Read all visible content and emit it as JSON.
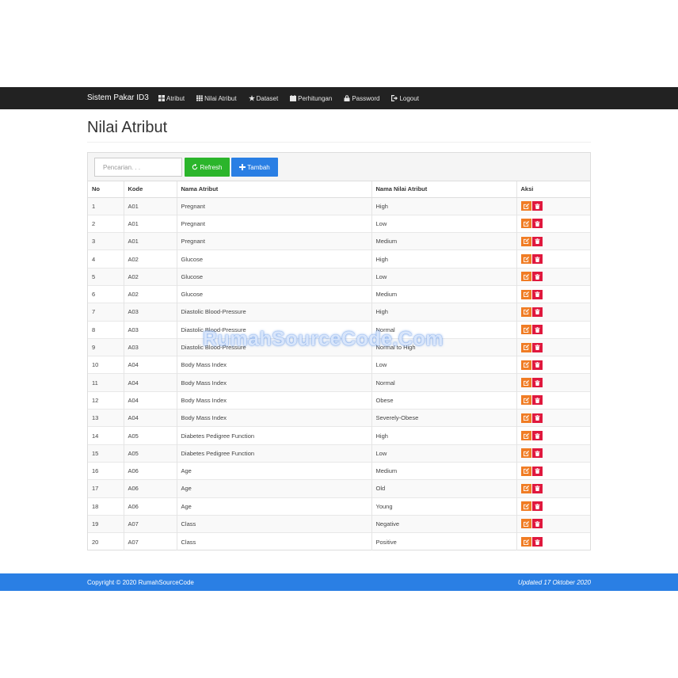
{
  "navbar": {
    "brand": "Sistem Pakar ID3",
    "items": [
      {
        "label": "Atribut",
        "icon": "grid-icon"
      },
      {
        "label": "Nilai Atribut",
        "icon": "list-grid-icon"
      },
      {
        "label": "Dataset",
        "icon": "star-icon"
      },
      {
        "label": "Perhitungan",
        "icon": "calendar-icon"
      },
      {
        "label": "Password",
        "icon": "lock-icon"
      },
      {
        "label": "Logout",
        "icon": "logout-icon"
      }
    ]
  },
  "page": {
    "title": "Nilai Atribut"
  },
  "toolbar": {
    "search_placeholder": "Pencarian. . .",
    "refresh_label": "Refresh",
    "add_label": "Tambah"
  },
  "table": {
    "headers": [
      "No",
      "Kode",
      "Nama Atribut",
      "Nama Nilai Atribut",
      "Aksi"
    ],
    "rows": [
      [
        "1",
        "A01",
        "Pregnant",
        "High"
      ],
      [
        "2",
        "A01",
        "Pregnant",
        "Low"
      ],
      [
        "3",
        "A01",
        "Pregnant",
        "Medium"
      ],
      [
        "4",
        "A02",
        "Glucose",
        "High"
      ],
      [
        "5",
        "A02",
        "Glucose",
        "Low"
      ],
      [
        "6",
        "A02",
        "Glucose",
        "Medium"
      ],
      [
        "7",
        "A03",
        "Diastolic Blood-Pressure",
        "High"
      ],
      [
        "8",
        "A03",
        "Diastolic Blood-Pressure",
        "Normal"
      ],
      [
        "9",
        "A03",
        "Diastolic Blood-Pressure",
        "Normal to High"
      ],
      [
        "10",
        "A04",
        "Body Mass Index",
        "Low"
      ],
      [
        "11",
        "A04",
        "Body Mass Index",
        "Normal"
      ],
      [
        "12",
        "A04",
        "Body Mass Index",
        "Obese"
      ],
      [
        "13",
        "A04",
        "Body Mass Index",
        "Severely-Obese"
      ],
      [
        "14",
        "A05",
        "Diabetes Pedigree Function",
        "High"
      ],
      [
        "15",
        "A05",
        "Diabetes Pedigree Function",
        "Low"
      ],
      [
        "16",
        "A06",
        "Age",
        "Medium"
      ],
      [
        "17",
        "A06",
        "Age",
        "Old"
      ],
      [
        "18",
        "A06",
        "Age",
        "Young"
      ],
      [
        "19",
        "A07",
        "Class",
        "Negative"
      ],
      [
        "20",
        "A07",
        "Class",
        "Positive"
      ]
    ]
  },
  "watermark": "RumahSourceCode.Com",
  "footer": {
    "copyright": "Copyright © 2020 RumahSourceCode",
    "updated": "Updated 17 Oktober 2020"
  },
  "colors": {
    "navbar": "#222222",
    "refresh": "#2bb52b",
    "add": "#2a7fe4",
    "edit": "#f07c24",
    "delete": "#e0183d",
    "footer": "#2a7fe4"
  }
}
